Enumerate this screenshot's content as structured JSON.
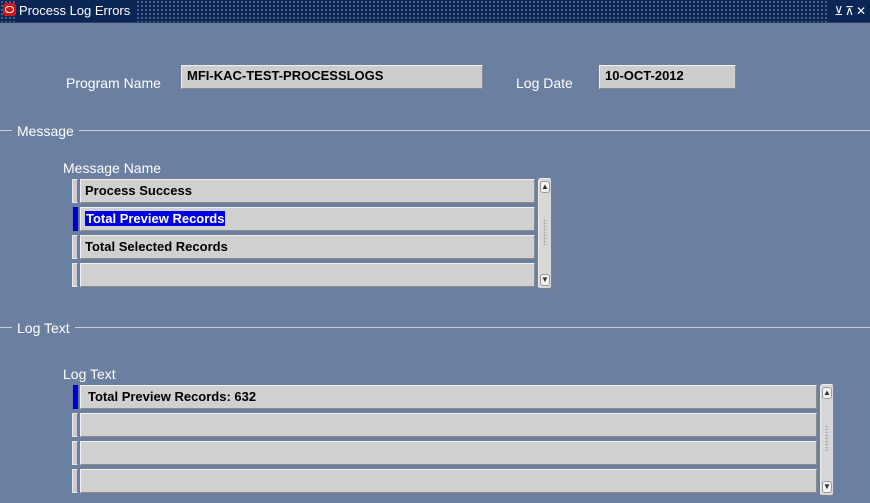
{
  "window": {
    "title": "Process Log Errors",
    "controls": "⊻ ⊼ ✕"
  },
  "header": {
    "program_name_label": "Program Name",
    "program_name_value": "MFI-KAC-TEST-PROCESSLOGS",
    "log_date_label": "Log Date",
    "log_date_value": "10-OCT-2012"
  },
  "message_section": {
    "title": "Message",
    "column_label": "Message Name",
    "rows": [
      "Process Success",
      "Total Preview Records",
      "Total Selected Records",
      ""
    ],
    "selected_index": 1
  },
  "log_section": {
    "title": "Log Text",
    "column_label": "Log Text",
    "rows": [
      "Total Preview Records: 632",
      "",
      "",
      ""
    ],
    "current_index": 0
  }
}
